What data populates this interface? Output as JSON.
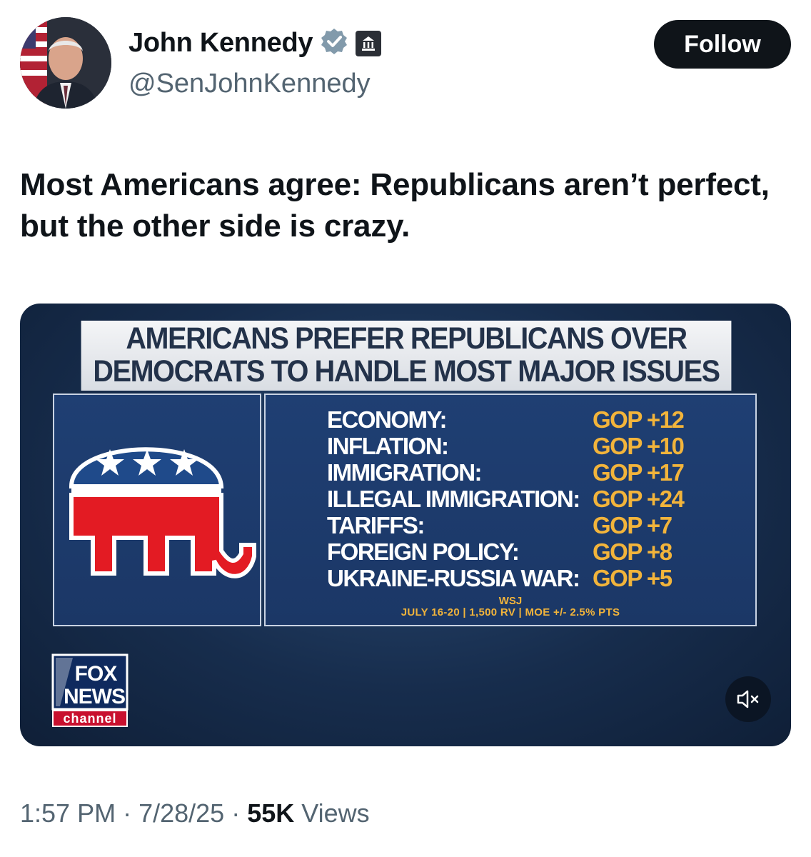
{
  "author": {
    "name": "John Kennedy",
    "handle": "@SenJohnKennedy"
  },
  "follow_label": "Follow",
  "tweet_text": "Most Americans agree: Republicans aren’t perfect, but the other side is crazy.",
  "media": {
    "headline_line1": "AMERICANS PREFER REPUBLICANS OVER",
    "headline_line2": "DEMOCRATS TO HANDLE MOST MAJOR ISSUES",
    "issues": [
      {
        "label": "ECONOMY:",
        "value": "GOP +12"
      },
      {
        "label": "INFLATION:",
        "value": "GOP +10"
      },
      {
        "label": "IMMIGRATION:",
        "value": "GOP +17"
      },
      {
        "label": "ILLEGAL IMMIGRATION:",
        "value": "GOP +24"
      },
      {
        "label": "TARIFFS:",
        "value": "GOP +7"
      },
      {
        "label": "FOREIGN POLICY:",
        "value": "GOP +8"
      },
      {
        "label": "UKRAINE-RUSSIA WAR:",
        "value": "GOP +5"
      }
    ],
    "source_name": "WSJ",
    "source_details": "JULY 16-20 | 1,500 RV | MOE +/- 2.5% PTS",
    "network_logo_text": [
      "FOX",
      "NEWS",
      "channel"
    ]
  },
  "meta": {
    "time": "1:57 PM",
    "separator": "·",
    "date": "7/28/25",
    "views_count": "55K",
    "views_label": "Views"
  },
  "colors": {
    "accent_gold": "#f2b43b",
    "panel_navy": "#1f3f73",
    "verified_blue": "#829aab",
    "gop_red": "#e31b23"
  },
  "icons": [
    "verified-badge-icon",
    "government-building-icon",
    "gop-elephant-logo",
    "fox-news-logo",
    "mute-icon"
  ]
}
